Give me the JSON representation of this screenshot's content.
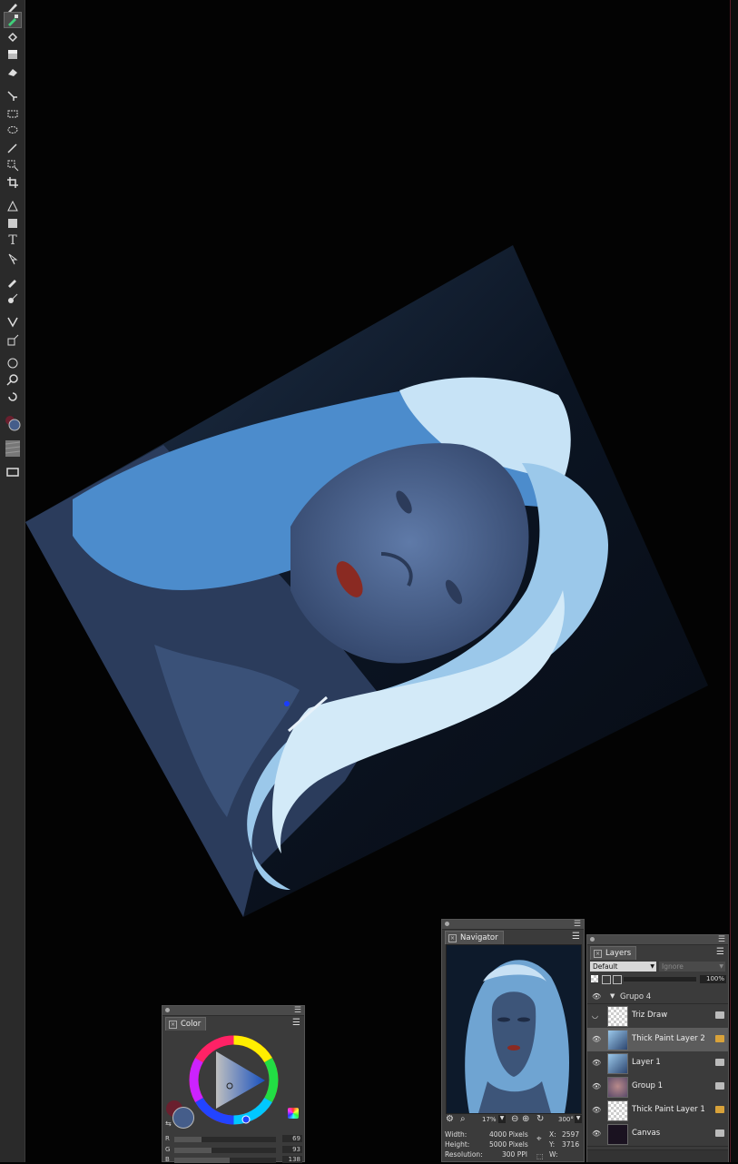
{
  "colors": {
    "background": "#030303",
    "toolbar": "#2a2a2a",
    "panel": "#3b3b3b",
    "selected_layer": "#5c5c5c",
    "primary_color": "#455d8a",
    "secondary_color": "#6a1f2e"
  },
  "toolbox": {
    "tools": [
      "brush-tool-icon",
      "eyedropper-icon",
      "fill-bucket-icon",
      "gradient-icon",
      "eraser-icon",
      "move-tool-icon",
      "rectangle-select-icon",
      "lasso-icon",
      "magic-wand-icon",
      "transform-select-icon",
      "crop-icon",
      "pen-icon",
      "rectangle-shape-icon",
      "text-tool-icon",
      "direct-select-icon",
      "dropper-tool-icon",
      "blend-tool-icon",
      "warp-icon",
      "perspective-icon",
      "grabber-hand-icon",
      "zoom-icon",
      "rotate-page-icon",
      "color-swatch-icon",
      "paper-texture-icon",
      "screen-mode-icon"
    ],
    "text_tool_glyph": "T"
  },
  "navigator": {
    "title": "Navigator",
    "zoom": "17%",
    "rotation": "300°",
    "width_label": "Width:",
    "width_value": "4000 Pixels",
    "height_label": "Height:",
    "height_value": "5000 Pixels",
    "resolution_label": "Resolution:",
    "resolution_value": "300 PPI",
    "x_label": "X:",
    "x_value": "2597",
    "y_label": "Y:",
    "y_value": "3716",
    "w_label": "W:"
  },
  "layers": {
    "title": "Layers",
    "composite_method": "Default",
    "composite_depth": "Ignore",
    "opacity": "100%",
    "group_name": "Grupo 4",
    "items": [
      {
        "name": "Triz Draw",
        "thumb": "checker",
        "visible": false
      },
      {
        "name": "Thick Paint Layer 2",
        "thumb": "art",
        "visible": true
      },
      {
        "name": "Layer 1",
        "thumb": "art",
        "visible": true
      },
      {
        "name": "Group 1",
        "thumb": "face",
        "visible": true
      },
      {
        "name": "Thick Paint Layer 1",
        "thumb": "checker",
        "visible": true
      },
      {
        "name": "Canvas",
        "thumb": "dark",
        "visible": true
      }
    ]
  },
  "color_panel": {
    "title": "Color",
    "r_label": "R",
    "r_value": "69",
    "g_label": "G",
    "g_value": "93",
    "b_label": "B",
    "b_value": "138",
    "r": 69,
    "g": 93,
    "b": 138
  }
}
